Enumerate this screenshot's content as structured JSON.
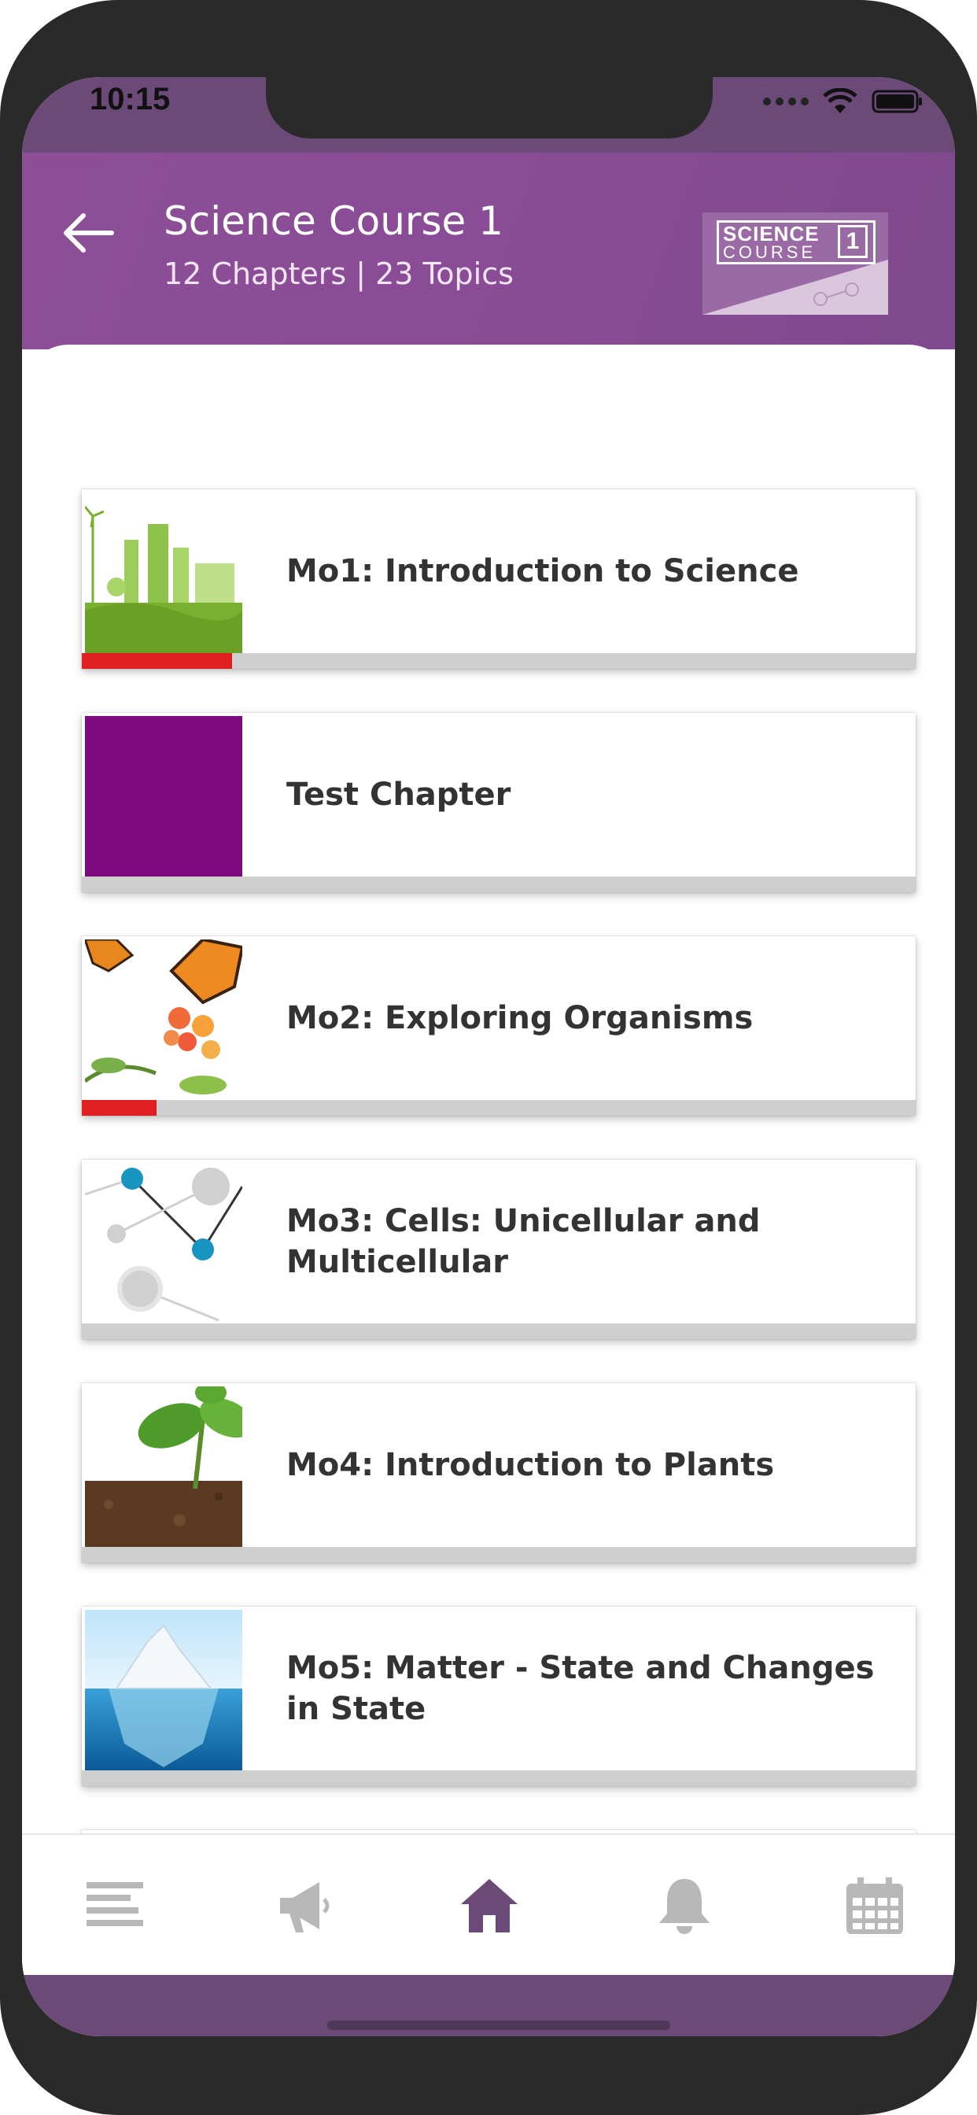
{
  "status_bar": {
    "time": "10:15"
  },
  "header": {
    "title": "Science Course 1",
    "subtitle": "12 Chapters | 23 Topics",
    "logo": {
      "line1": "SCIENCE",
      "line2": "COURSE",
      "number": "1"
    }
  },
  "chapters": [
    {
      "title": "Mo1: Introduction to Science",
      "progress": 0.18,
      "thumb": "city-green"
    },
    {
      "title": "Test Chapter",
      "progress": 0,
      "thumb": "purple-block"
    },
    {
      "title": "Mo2: Exploring Organisms",
      "progress": 0.09,
      "thumb": "butterfly"
    },
    {
      "title": "Mo3: Cells: Unicellular and Multicellular",
      "progress": 0,
      "thumb": "molecules"
    },
    {
      "title": "Mo4: Introduction to Plants",
      "progress": 0,
      "thumb": "sprout"
    },
    {
      "title": "Mo5: Matter - State and Changes in State",
      "progress": 0,
      "thumb": "iceberg"
    },
    {
      "title": "",
      "progress": 0,
      "thumb": "atoms-partial"
    }
  ],
  "tabbar": {
    "items": [
      {
        "name": "menu-icon",
        "active": false
      },
      {
        "name": "megaphone-icon",
        "active": false
      },
      {
        "name": "home-icon",
        "active": true
      },
      {
        "name": "bell-icon",
        "active": false
      },
      {
        "name": "calendar-icon",
        "active": false
      }
    ],
    "active_color": "#6b4a78",
    "inactive_color": "#b8b8b8"
  },
  "colors": {
    "brand": "#8e4e98",
    "progress": "#e02020"
  }
}
